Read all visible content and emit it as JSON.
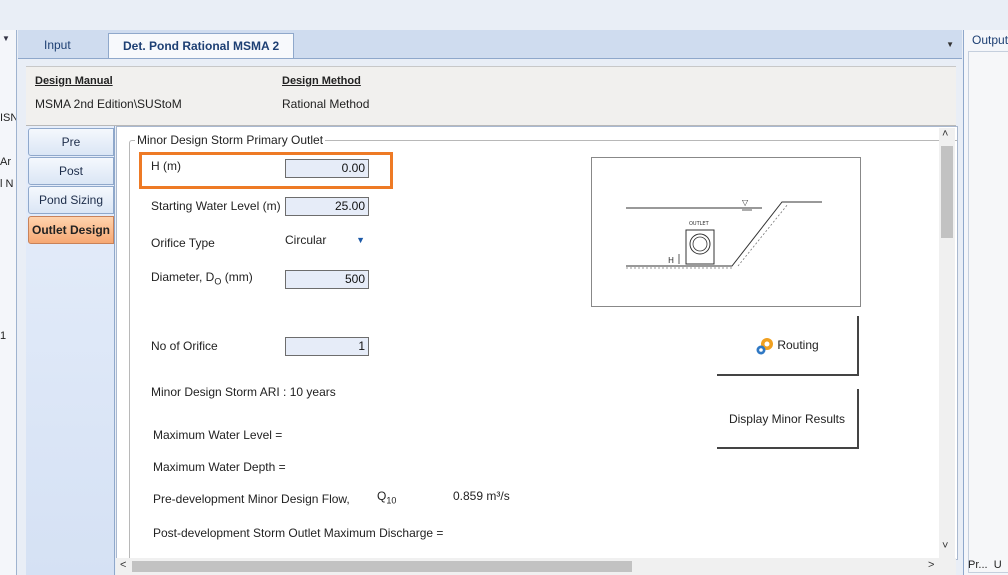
{
  "left_panel": {
    "labels": [
      "ISN",
      "Ar",
      "l N",
      "1"
    ]
  },
  "tabs": [
    {
      "label": "Input"
    },
    {
      "label": "Det. Pond Rational MSMA 2"
    }
  ],
  "header": {
    "design_manual_label": "Design Manual",
    "design_manual_value": "MSMA 2nd Edition\\SUStoM",
    "design_method_label": "Design Method",
    "design_method_value": "Rational Method"
  },
  "side_tabs": [
    {
      "label": "Pre"
    },
    {
      "label": "Post"
    },
    {
      "label": "Pond Sizing"
    },
    {
      "label": "Outlet Design"
    }
  ],
  "form": {
    "group_title": "Minor Design Storm Primary Outlet",
    "h_label": "H (m)",
    "h_value": "0.00",
    "start_level_label": "Starting Water Level (m)",
    "start_level_value": "25.00",
    "orifice_type_label": "Orifice Type",
    "orifice_type_value": "Circular",
    "diameter_label": "Diameter, D",
    "diameter_sub": "O",
    "diameter_unit": "(mm)",
    "diameter_value": "500",
    "num_orifice_label": "No of Orifice",
    "num_orifice_value": "1",
    "ari_text": "Minor Design Storm ARI : 10 years",
    "max_level_label": "Maximum Water Level =",
    "max_depth_label": "Maximum Water Depth =",
    "pre_dev_label": "Pre-development Minor Design Flow,",
    "q_symbol": "Q",
    "q_sub": "10",
    "q_value": "0.859 m³/s",
    "post_dev_label": "Post-development Storm Outlet Maximum Discharge ="
  },
  "diagram": {
    "outlet_label": "OUTLET",
    "h_marker": "H"
  },
  "buttons": {
    "routing": "Routing",
    "display_minor": "Display Minor Results"
  },
  "right_panel": {
    "title": "Output",
    "bottom_labels": [
      "Pr...",
      "U"
    ]
  }
}
